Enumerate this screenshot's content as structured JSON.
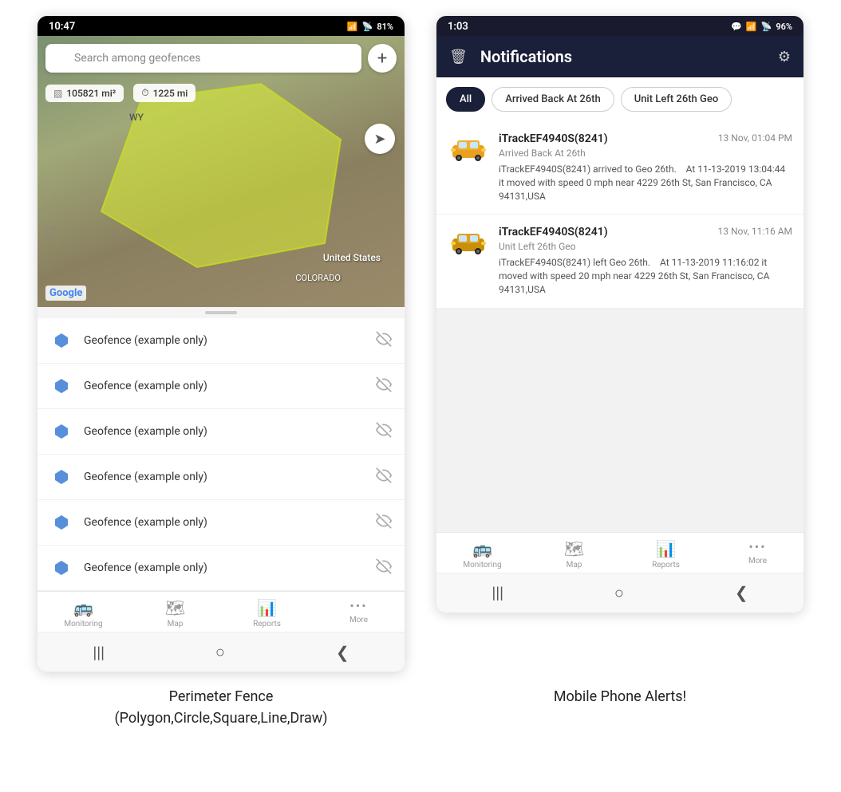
{
  "left_phone": {
    "status_bar": {
      "time": "10:47",
      "wifi": "WiFi",
      "signal": "81%",
      "battery": "81%"
    },
    "search": {
      "placeholder": "Search among geofences"
    },
    "map": {
      "stat1": "105821 mi²",
      "stat2": "1225 mi",
      "label_us": "United States",
      "label_co": "COLORADO",
      "label_wy": "WY",
      "label_ut": "UT",
      "google": "Google"
    },
    "geofences": [
      {
        "name": "Geofence (example only)"
      },
      {
        "name": "Geofence (example only)"
      },
      {
        "name": "Geofence (example only)"
      },
      {
        "name": "Geofence (example only)"
      },
      {
        "name": "Geofence (example only)"
      },
      {
        "name": "Geofence (example only)"
      }
    ],
    "bottom_nav": [
      {
        "label": "Monitoring",
        "icon": "🚌"
      },
      {
        "label": "Map",
        "icon": "🗺"
      },
      {
        "label": "Reports",
        "icon": "📊"
      },
      {
        "label": "More",
        "icon": "···"
      }
    ],
    "caption": "Perimeter Fence\n(Polygon,Circle,Square,Line,Draw)"
  },
  "right_phone": {
    "status_bar": {
      "time": "1:03",
      "battery": "96%"
    },
    "header": {
      "title": "Notifications"
    },
    "filters": [
      {
        "label": "All",
        "active": true
      },
      {
        "label": "Arrived Back At 26th",
        "active": false
      },
      {
        "label": "Unit Left 26th Geo",
        "active": false
      }
    ],
    "notifications": [
      {
        "device": "iTrackEF4940S(8241)",
        "time": "13 Nov, 01:04 PM",
        "event": "Arrived Back At 26th",
        "desc": "iTrackEF4940S(8241) arrived to Geo 26th.   At 11-13-2019 13:04:44 it moved with speed 0 mph near 4229 26th St, San Francisco, CA 94131,USA"
      },
      {
        "device": "iTrackEF4940S(8241)",
        "time": "13 Nov, 11:16 AM",
        "event": "Unit Left 26th Geo",
        "desc": "iTrackEF4940S(8241) left Geo 26th.   At 11-13-2019 11:16:02 it moved with speed 20 mph near 4229 26th St, San Francisco, CA 94131,USA"
      }
    ],
    "bottom_nav": [
      {
        "label": "Monitoring",
        "icon": "🚌"
      },
      {
        "label": "Map",
        "icon": "🗺"
      },
      {
        "label": "Reports",
        "icon": "📊"
      },
      {
        "label": "More",
        "icon": "···"
      }
    ],
    "caption": "Mobile Phone Alerts!"
  },
  "icons": {
    "search": "🔍",
    "plus": "+",
    "eye_off": "👁",
    "compass": "➤",
    "trash": "🗑",
    "gear": "⚙",
    "car_yellow": "🚕",
    "car_gold": "🚖",
    "back": "❮",
    "home": "○",
    "menu": "|||"
  }
}
